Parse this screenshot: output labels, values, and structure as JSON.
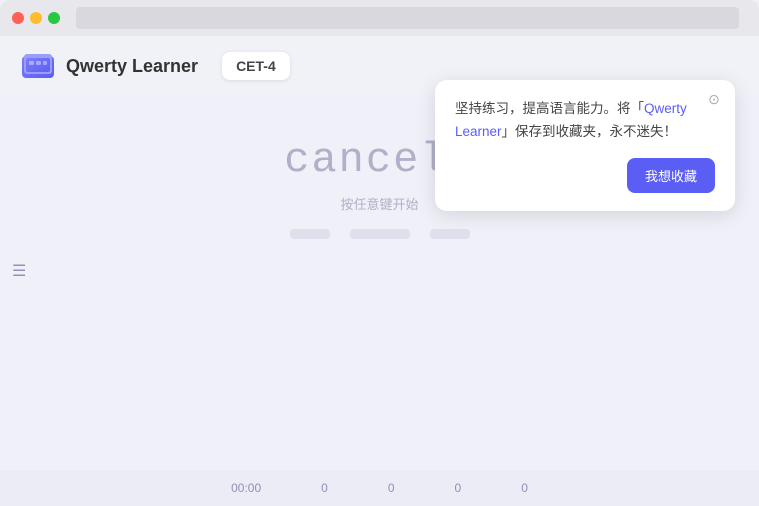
{
  "browser": {
    "traffic": [
      "red",
      "yellow",
      "green"
    ]
  },
  "navbar": {
    "logo_text": "Qwerty Learner",
    "cet_badge": "CET-4"
  },
  "tooltip": {
    "close_icon": "⊙",
    "text_part1": "坚持练习，提高语言能力。将「",
    "highlight": "Qwerty Learner",
    "text_part2": "」保存到收藏夹，永不迷失！",
    "bookmark_label": "我想收藏"
  },
  "main": {
    "word": "cancel",
    "cursor": "◄",
    "hint": "按任意键开始"
  },
  "bottom": {
    "time": "00:00",
    "stats": [
      "0",
      "0",
      "0",
      "0"
    ]
  }
}
